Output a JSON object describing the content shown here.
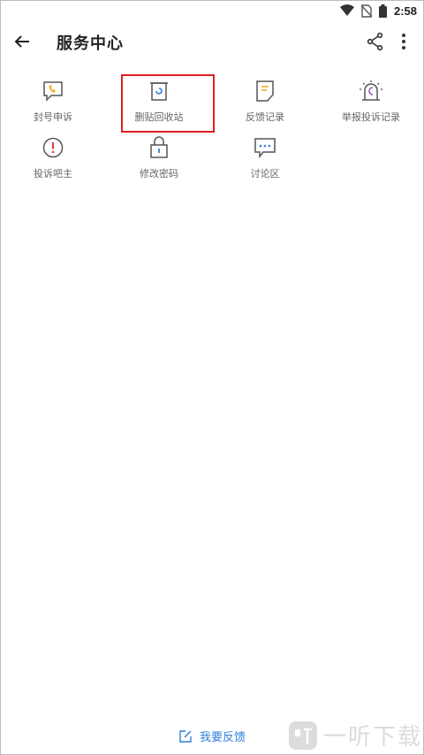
{
  "status": {
    "time": "2:58"
  },
  "appbar": {
    "title": "服务中心"
  },
  "tiles": [
    {
      "label": "封号申诉",
      "icon": "appeal-phone-icon",
      "color": "#f5a623"
    },
    {
      "label": "删贴回收站",
      "icon": "recycle-bin-icon",
      "color": "#2f7fd8"
    },
    {
      "label": "反馈记录",
      "icon": "feedback-record-icon",
      "color": "#f5a623"
    },
    {
      "label": "举报投诉记录",
      "icon": "report-alarm-icon",
      "color": "#9b59b6"
    },
    {
      "label": "投诉吧主",
      "icon": "complaint-alert-icon",
      "color": "#e53935"
    },
    {
      "label": "修改密码",
      "icon": "lock-icon",
      "color": "#2f7fd8"
    },
    {
      "label": "讨论区",
      "icon": "discussion-icon",
      "color": "#2f7fd8"
    }
  ],
  "feedback": {
    "label": "我要反馈"
  },
  "watermark": {
    "text": "一听下载"
  }
}
